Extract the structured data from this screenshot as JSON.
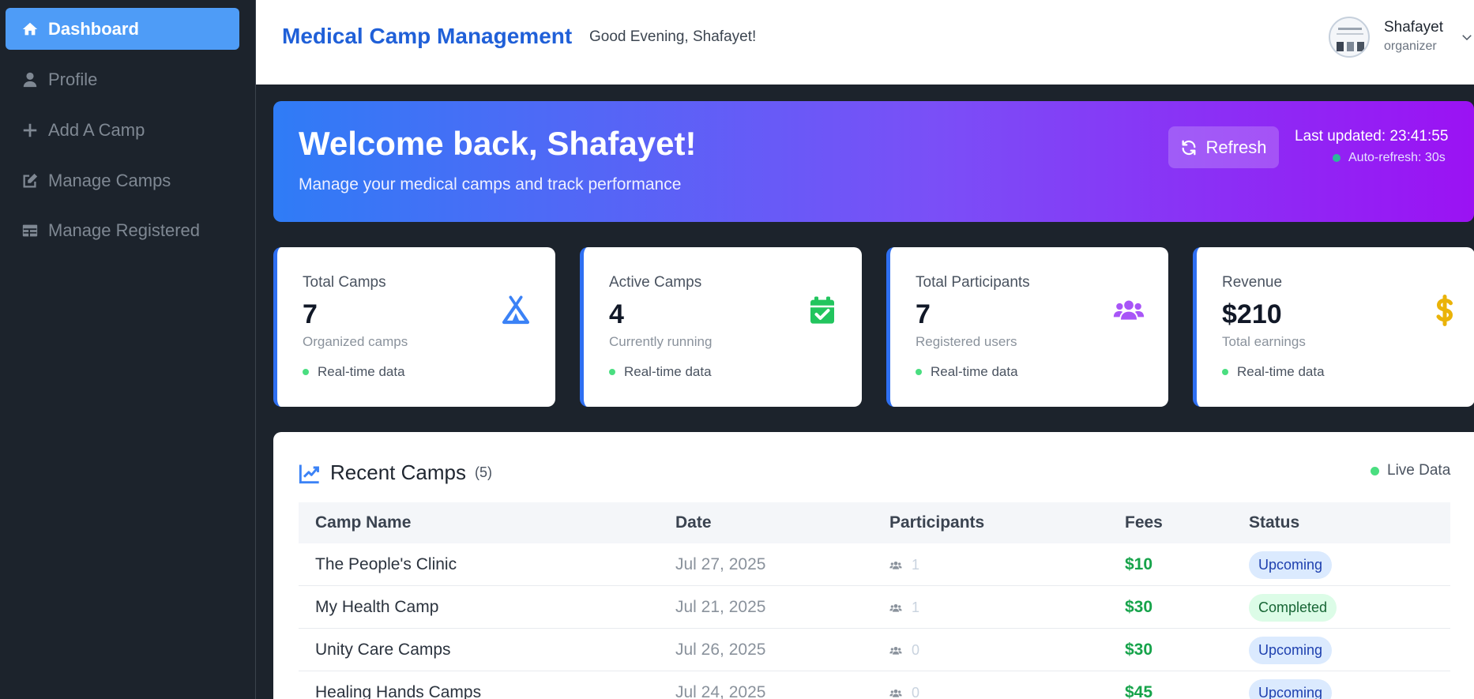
{
  "sidebar": {
    "items": [
      {
        "label": "Dashboard",
        "icon": "home-icon",
        "active": true
      },
      {
        "label": "Profile",
        "icon": "user-icon",
        "active": false
      },
      {
        "label": "Add A Camp",
        "icon": "plus-icon",
        "active": false
      },
      {
        "label": "Manage Camps",
        "icon": "edit-icon",
        "active": false
      },
      {
        "label": "Manage Registered",
        "icon": "table-icon",
        "active": false
      }
    ]
  },
  "header": {
    "title": "Medical Camp Management",
    "greeting": "Good Evening, Shafayet!",
    "user": {
      "name": "Shafayet",
      "role": "organizer"
    }
  },
  "banner": {
    "title": "Welcome back, Shafayet!",
    "subtitle": "Manage your medical camps and track performance",
    "refresh_label": "Refresh",
    "last_updated": "Last updated: 23:41:55",
    "auto_refresh": "Auto-refresh: 30s"
  },
  "stats": [
    {
      "label": "Total Camps",
      "value": "7",
      "sub": "Organized camps",
      "live": "Real-time data",
      "icon": "tent-icon",
      "color": "#3b82f6"
    },
    {
      "label": "Active Camps",
      "value": "4",
      "sub": "Currently running",
      "live": "Real-time data",
      "icon": "calendar-check-icon",
      "color": "#22c55e"
    },
    {
      "label": "Total Participants",
      "value": "7",
      "sub": "Registered users",
      "live": "Real-time data",
      "icon": "users-icon",
      "color": "#a855f7"
    },
    {
      "label": "Revenue",
      "value": "$210",
      "sub": "Total earnings",
      "live": "Real-time data",
      "icon": "dollar-icon",
      "color": "#eab308"
    }
  ],
  "recent": {
    "title": "Recent Camps",
    "count": "(5)",
    "live_label": "Live Data",
    "columns": [
      "Camp Name",
      "Date",
      "Participants",
      "Fees",
      "Status"
    ],
    "rows": [
      {
        "name": "The People's Clinic",
        "date": "Jul 27, 2025",
        "participants": "1",
        "fees": "$10",
        "status": "Upcoming"
      },
      {
        "name": "My Health Camp",
        "date": "Jul 21, 2025",
        "participants": "1",
        "fees": "$30",
        "status": "Completed"
      },
      {
        "name": "Unity Care Camps",
        "date": "Jul 26, 2025",
        "participants": "0",
        "fees": "$30",
        "status": "Upcoming"
      },
      {
        "name": "Healing Hands Camps",
        "date": "Jul 24, 2025",
        "participants": "0",
        "fees": "$45",
        "status": "Upcoming"
      }
    ]
  },
  "colors": {
    "accent": "#4e9cf7",
    "brand": "#2060d8",
    "sidebar_bg": "#1c232c",
    "success": "#16a34a"
  }
}
